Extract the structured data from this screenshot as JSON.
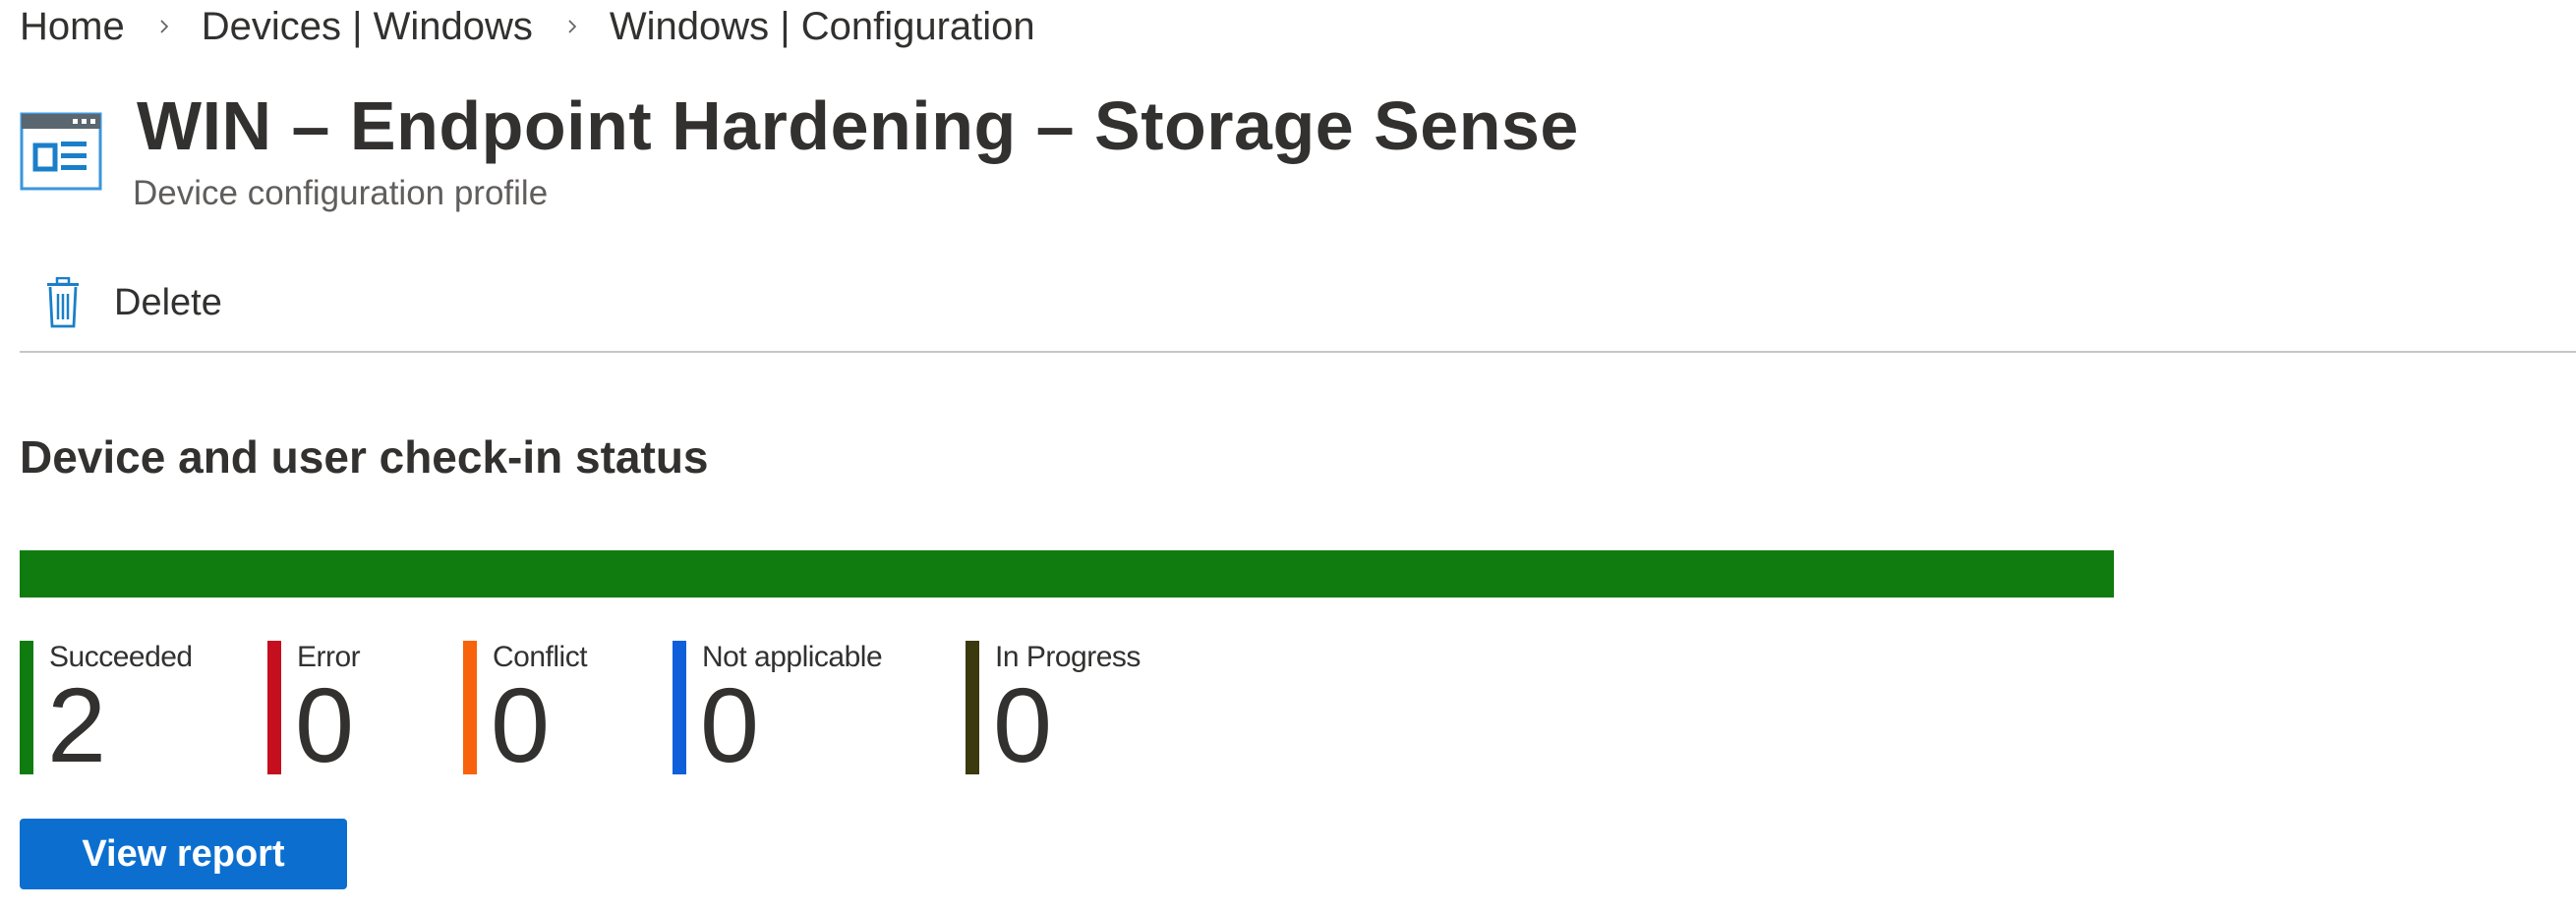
{
  "breadcrumb": [
    {
      "label": "Home"
    },
    {
      "label": "Devices | Windows"
    },
    {
      "label": "Windows | Configuration"
    }
  ],
  "header": {
    "title": "WIN – Endpoint Hardening – Storage Sense",
    "subtitle": "Device configuration profile",
    "icon": "device-configuration-profile-icon"
  },
  "commandbar": {
    "delete_label": "Delete",
    "delete_icon": "trash-icon"
  },
  "checkin": {
    "title": "Device and user check-in status",
    "statuses": [
      {
        "label": "Succeeded",
        "value": 2,
        "color": "#107c10"
      },
      {
        "label": "Error",
        "value": 0,
        "color": "#c50f1f"
      },
      {
        "label": "Conflict",
        "value": 0,
        "color": "#f7630c"
      },
      {
        "label": "Not applicable",
        "value": 0,
        "color": "#0f5fdb"
      },
      {
        "label": "In Progress",
        "value": 0,
        "color": "#3b3a0f"
      }
    ],
    "view_report_label": "View report"
  }
}
